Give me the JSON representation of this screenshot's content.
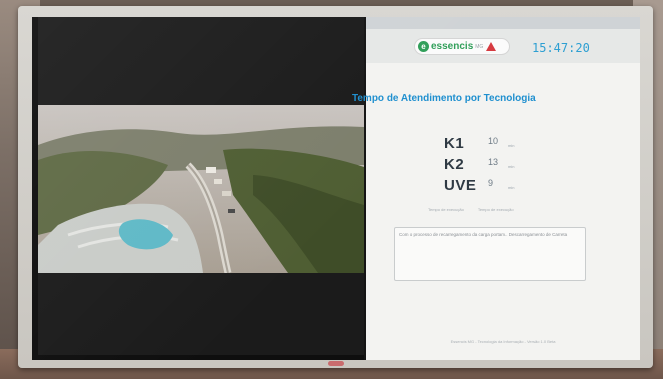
{
  "window": {
    "topbar_text": ""
  },
  "dashboard": {
    "brand": {
      "icon": "e",
      "name": "essencis",
      "sub": "MG",
      "warning_icon": "warning-triangle-icon"
    },
    "clock": "15:47:20",
    "title": "Tempo de Atendimento por Tecnologia",
    "metrics": [
      {
        "code": "K1",
        "value": "10",
        "unit": "min"
      },
      {
        "code": "K2",
        "value": "13",
        "unit": "min"
      },
      {
        "code": "UVE",
        "value": "9",
        "unit": "min"
      }
    ],
    "legend": [
      "Tempo de execução",
      "Tempo de execução"
    ],
    "notice_text": "Com o processo de recarregamento da carga portam.. Descarregamento de Carreta",
    "footer": "Essencis MG - Tecnologia da Informação - Versão 1.0 Beta"
  },
  "colors": {
    "accent_blue": "#1e8fcf",
    "brand_green": "#2f9e58",
    "warning_red": "#d6393f",
    "clock_blue": "#2d9fd2"
  }
}
